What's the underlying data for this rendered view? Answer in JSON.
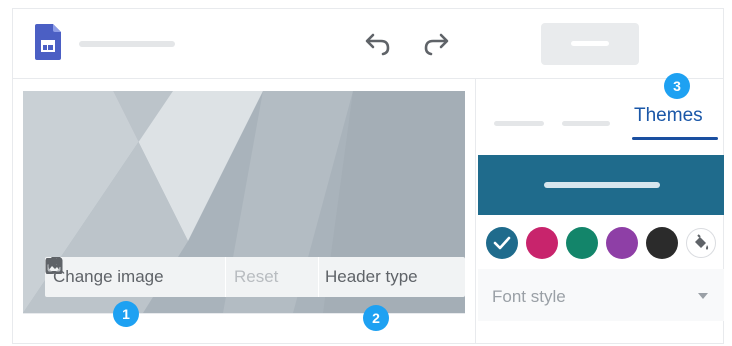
{
  "toolbar": {
    "change_image_label": "Change image",
    "reset_label": "Reset",
    "header_type_label": "Header type"
  },
  "callouts": [
    "1",
    "2",
    "3"
  ],
  "panel": {
    "active_tab_label": "Themes",
    "font_style_label": "Font style",
    "banner_color": "#1f6b8c",
    "swatches": [
      {
        "color": "#1f6b8c",
        "selected": true
      },
      {
        "color": "#c8246c",
        "selected": false
      },
      {
        "color": "#13856a",
        "selected": false
      },
      {
        "color": "#8e3fa6",
        "selected": false
      },
      {
        "color": "#2b2b2b",
        "selected": false
      }
    ]
  },
  "accent_color": "#1ea1f2",
  "icons": [
    "sites-logo-icon",
    "undo-icon",
    "redo-icon",
    "image-icon",
    "dropdown-caret-icon",
    "reset-icon",
    "header-type-icon",
    "checkmark-icon",
    "paint-bucket-icon"
  ]
}
